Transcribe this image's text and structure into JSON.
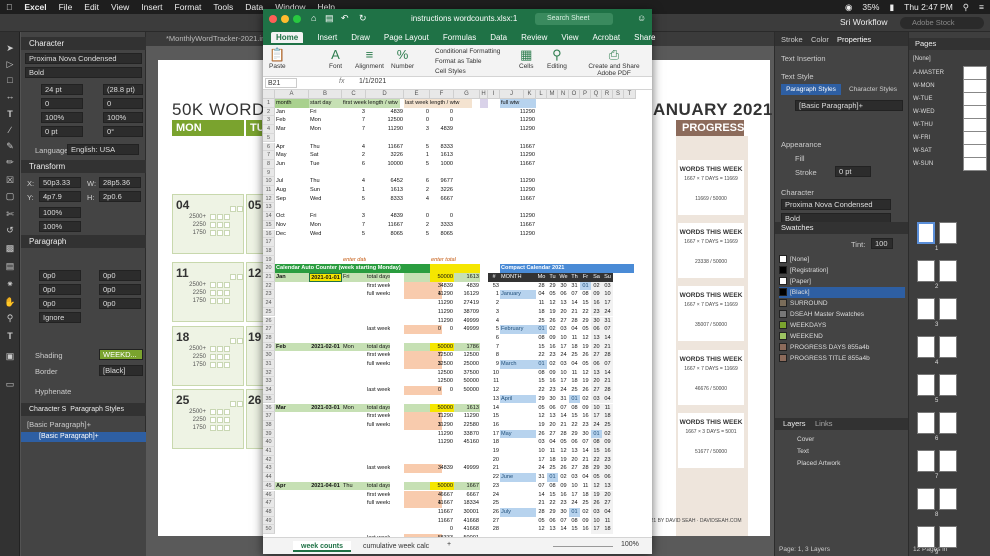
{
  "menubar": {
    "app": "Excel",
    "items": [
      "File",
      "Edit",
      "View",
      "Insert",
      "Format",
      "Tools",
      "Data",
      "Window",
      "Help"
    ],
    "battery": "35%",
    "time": "Thu 2:47 PM"
  },
  "indesign": {
    "doc_tab": "*MonthlyWordTracker-2021.indd @ 1",
    "workspace": "Sri Workflow",
    "search_placeholder": "Adobe Stock"
  },
  "character": {
    "title": "Character",
    "font": "Proxima Nova Condensed",
    "style": "Bold",
    "size": "24 pt",
    "leading": "(28.8 pt)",
    "tracking": "0",
    "kern": "0",
    "scale_v": "100%",
    "scale_h": "100%",
    "baseline": "0 pt",
    "skew": "0°",
    "language_label": "Language:",
    "language": "English: USA"
  },
  "transform": {
    "title": "Transform",
    "x": "50p3.33",
    "y": "4p7.9",
    "w": "28p5.36",
    "h": "2p0.6"
  },
  "paragraph": {
    "title": "Paragraph",
    "indent1": "0p0",
    "indent2": "0p0",
    "indent3": "0p0",
    "indent4": "0p0",
    "space1": "0p0",
    "space2": "0p0",
    "mode": "Ignore",
    "shading_label": "Shading",
    "shading": "WEEKD...",
    "border_label": "Border",
    "border": "[Black]",
    "hyphenate": "Hyphenate"
  },
  "pstyles": {
    "tab1": "Character S",
    "tab2": "Paragraph Styles",
    "current": "[Basic Paragraph]+",
    "item": "[Basic Paragraph]+"
  },
  "doc": {
    "title_left": "50K WORD TR",
    "title_right": "ANUARY 2021",
    "days": [
      "MON",
      "TU"
    ],
    "progress": "PROGRESS",
    "dates_mon": [
      "04",
      "11",
      "18",
      "25"
    ],
    "dates_tue": [
      "05",
      "12",
      "19",
      "26"
    ],
    "targets": [
      "2500+",
      "2250",
      "1750"
    ],
    "footer": "© 2021 BY DAVID SEAH · DAVIDSEAH.COM",
    "progress_blocks": [
      {
        "t": "WORDS THIS WEEK",
        "s": "1667 × 7 DAYS = 11669",
        "v": "11669 / 50000"
      },
      {
        "t": "WORDS THIS WEEK",
        "s": "1667 × 7 DAYS = 11669",
        "v": "23338 / 50000"
      },
      {
        "t": "WORDS THIS WEEK",
        "s": "1667 × 7 DAYS = 11669",
        "v": "35007 / 50000"
      },
      {
        "t": "WORDS THIS WEEK",
        "s": "1667 × 7 DAYS = 11669",
        "v": "46676 / 50000"
      },
      {
        "t": "WORDS THIS WEEK",
        "s": "1667 × 3 DAYS = 5001",
        "v": "51677 / 50000"
      }
    ]
  },
  "props": {
    "tabs": [
      "Stroke",
      "Color",
      "Properties"
    ],
    "text_insertion": "Text Insertion",
    "text_style": "Text Style",
    "ps_tab": "Paragraph Styles",
    "cs_tab": "Character Styles",
    "para_style": "[Basic Paragraph]+",
    "appearance": "Appearance",
    "fill": "Fill",
    "stroke": "Stroke",
    "stroke_val": "0 pt",
    "character": "Character",
    "font": "Proxima Nova Condensed",
    "weight": "Bold"
  },
  "swatches": {
    "title": "Swatches",
    "tint_label": "Tint:",
    "tint": "100",
    "items": [
      "[None]",
      "[Registration]",
      "[Paper]",
      "[Black]",
      "SURROUND",
      "DSEAH Master Swatches",
      "WEEKDAYS",
      "WEEKEND",
      "PROGRESS DAYS 855a4b",
      "PROGRESS TITLE 855a4b"
    ]
  },
  "layers": {
    "tabs": [
      "Layers",
      "Links"
    ],
    "items": [
      "Cover",
      "Text",
      "Placed Artwork"
    ],
    "footer": "Page: 1, 3 Layers"
  },
  "pages": {
    "title": "Pages",
    "none": "[None]",
    "masters": [
      "A-MASTER",
      "W-MON",
      "W-TUE",
      "W-WED",
      "W-THU",
      "W-FRI",
      "W-SAT",
      "W-SUN"
    ],
    "numbers": [
      "1",
      "2",
      "3",
      "4",
      "5",
      "6",
      "7",
      "8",
      "9",
      "10"
    ],
    "footer": "12 Pages in"
  },
  "excel": {
    "title": "instructions wordcounts.xlsx:1",
    "search": "Search Sheet",
    "tabs": [
      "Home",
      "Insert",
      "Draw",
      "Page Layout",
      "Formulas",
      "Data",
      "Review",
      "View",
      "Acrobat"
    ],
    "share": "Share",
    "ribbon": [
      "Paste",
      "Font",
      "Alignment",
      "Number",
      "Conditional Formatting",
      "Format as Table",
      "Cell Styles",
      "Cells",
      "Editing",
      "Create and Share Adobe PDF"
    ],
    "namebox": "B21",
    "fx": "fx",
    "formula": "1/1/2021",
    "cols": [
      "A",
      "B",
      "C",
      "D",
      "E",
      "F",
      "G",
      "H",
      "I",
      "J",
      "K",
      "L",
      "M",
      "N",
      "O",
      "P",
      "Q",
      "R",
      "S",
      "T"
    ],
    "headers": [
      "month",
      "start day",
      "first week length / wtw",
      "last week length / wtw",
      "full wtw"
    ],
    "months": [
      [
        "Jan",
        "Fri",
        "3",
        "4839",
        "0",
        "0",
        "11290"
      ],
      [
        "Feb",
        "Mon",
        "7",
        "12500",
        "0",
        "0",
        "11290"
      ],
      [
        "Mar",
        "Mon",
        "7",
        "11290",
        "3",
        "4839",
        "11290"
      ],
      [
        "",
        "",
        "",
        "",
        "",
        "",
        ""
      ],
      [
        "Apr",
        "Thu",
        "4",
        "11667",
        "5",
        "8333",
        "11667"
      ],
      [
        "May",
        "Sat",
        "2",
        "3226",
        "1",
        "1613",
        "11290"
      ],
      [
        "Jun",
        "Tue",
        "6",
        "10000",
        "5",
        "1000",
        "11667"
      ],
      [
        "",
        "",
        "",
        "",
        "",
        "",
        ""
      ],
      [
        "Jul",
        "Thu",
        "4",
        "6452",
        "6",
        "9677",
        "11290"
      ],
      [
        "Aug",
        "Sun",
        "1",
        "1613",
        "2",
        "3226",
        "11290"
      ],
      [
        "Sep",
        "Wed",
        "5",
        "8333",
        "4",
        "6667",
        "11667"
      ],
      [
        "",
        "",
        "",
        "",
        "",
        "",
        ""
      ],
      [
        "Oct",
        "Fri",
        "3",
        "4839",
        "0",
        "0",
        "11290"
      ],
      [
        "Nov",
        "Mon",
        "7",
        "11667",
        "2",
        "3333",
        "11667"
      ],
      [
        "Dec",
        "Wed",
        "5",
        "8065",
        "5",
        "8065",
        "11290"
      ]
    ],
    "auto_title": "Calendar Auto Counter (week starting Monday)",
    "enter_date": "enter date",
    "enter_total": "enter total",
    "compact_title": "Compact Calendar 2021",
    "counter": [
      [
        "21",
        "Jan",
        "2021-01-01",
        "Fri",
        "total days",
        "31",
        "50000",
        "1613"
      ],
      [
        "22",
        "",
        "",
        "",
        "first week",
        "3",
        "4839",
        "4839"
      ],
      [
        "23",
        "",
        "",
        "",
        "full weeks",
        "4",
        "11290",
        "16129"
      ],
      [
        "24",
        "",
        "",
        "",
        "",
        "",
        "11290",
        "27419"
      ],
      [
        "25",
        "",
        "",
        "",
        "",
        "",
        "11290",
        "38709"
      ],
      [
        "26",
        "",
        "",
        "",
        "",
        "",
        "11290",
        "49999"
      ],
      [
        "27",
        "",
        "",
        "",
        "last week",
        "0",
        "0",
        "49999"
      ],
      [
        "28",
        "",
        "",
        "",
        "",
        "",
        "",
        ""
      ],
      [
        "29",
        "Feb",
        "2021-02-01",
        "Mon",
        "total days",
        "28",
        "50000",
        "1786"
      ],
      [
        "30",
        "",
        "",
        "",
        "first week",
        "7",
        "12500",
        "12500"
      ],
      [
        "31",
        "",
        "",
        "",
        "full weeks",
        "3",
        "12500",
        "25000"
      ],
      [
        "32",
        "",
        "",
        "",
        "",
        "",
        "12500",
        "37500"
      ],
      [
        "33",
        "",
        "",
        "",
        "",
        "",
        "12500",
        "50000"
      ],
      [
        "34",
        "",
        "",
        "",
        "last week",
        "0",
        "0",
        "50000"
      ],
      [
        "35",
        "",
        "",
        "",
        "",
        "",
        "",
        ""
      ],
      [
        "36",
        "Mar",
        "2021-03-01",
        "Mon",
        "total days",
        "31",
        "50000",
        "1613"
      ],
      [
        "37",
        "",
        "",
        "",
        "first week",
        "7",
        "11290",
        "11290"
      ],
      [
        "38",
        "",
        "",
        "",
        "full weeks",
        "3",
        "11290",
        "22580"
      ],
      [
        "39",
        "",
        "",
        "",
        "",
        "",
        "11290",
        "33870"
      ],
      [
        "40",
        "",
        "",
        "",
        "",
        "",
        "11290",
        "45160"
      ],
      [
        "41",
        "",
        "",
        "",
        "",
        "",
        "",
        ""
      ],
      [
        "42",
        "",
        "",
        "",
        "",
        "",
        "",
        ""
      ],
      [
        "43",
        "",
        "",
        "",
        "last week",
        "3",
        "4839",
        "49999"
      ],
      [
        "44",
        "",
        "",
        "",
        "",
        "",
        "",
        ""
      ],
      [
        "45",
        "Apr",
        "2021-04-01",
        "Thu",
        "total days",
        "30",
        "50000",
        "1667"
      ],
      [
        "46",
        "",
        "",
        "",
        "first week",
        "4",
        "6667",
        "6667"
      ],
      [
        "47",
        "",
        "",
        "",
        "full weeks",
        "4",
        "11667",
        "18334"
      ],
      [
        "48",
        "",
        "",
        "",
        "",
        "",
        "11667",
        "30001"
      ],
      [
        "49",
        "",
        "",
        "",
        "",
        "",
        "11667",
        "41668"
      ],
      [
        "50",
        "",
        "",
        "",
        "",
        "",
        "0",
        "41668"
      ],
      [
        "51",
        "",
        "",
        "",
        "last week",
        "5",
        "8333",
        "50001"
      ],
      [
        "52",
        "",
        "",
        "",
        "",
        "",
        "",
        ""
      ],
      [
        "53",
        "",
        "",
        "",
        "",
        "",
        "",
        ""
      ]
    ],
    "compact_head": [
      "#",
      "MONTH",
      "Mo",
      "Tu",
      "We",
      "Th",
      "Fr",
      "Sa",
      "Su"
    ],
    "compact": [
      [
        "53",
        "",
        "28",
        "29",
        "30",
        "31",
        "01",
        "02",
        "03"
      ],
      [
        "1",
        "January",
        "04",
        "05",
        "06",
        "07",
        "08",
        "09",
        "10"
      ],
      [
        "2",
        "",
        "11",
        "12",
        "13",
        "14",
        "15",
        "16",
        "17"
      ],
      [
        "3",
        "",
        "18",
        "19",
        "20",
        "21",
        "22",
        "23",
        "24"
      ],
      [
        "4",
        "",
        "25",
        "26",
        "27",
        "28",
        "29",
        "30",
        "31"
      ],
      [
        "5",
        "February",
        "01",
        "02",
        "03",
        "04",
        "05",
        "06",
        "07"
      ],
      [
        "6",
        "",
        "08",
        "09",
        "10",
        "11",
        "12",
        "13",
        "14"
      ],
      [
        "7",
        "",
        "15",
        "16",
        "17",
        "18",
        "19",
        "20",
        "21"
      ],
      [
        "8",
        "",
        "22",
        "23",
        "24",
        "25",
        "26",
        "27",
        "28"
      ],
      [
        "9",
        "March",
        "01",
        "02",
        "03",
        "04",
        "05",
        "06",
        "07"
      ],
      [
        "10",
        "",
        "08",
        "09",
        "10",
        "11",
        "12",
        "13",
        "14"
      ],
      [
        "11",
        "",
        "15",
        "16",
        "17",
        "18",
        "19",
        "20",
        "21"
      ],
      [
        "12",
        "",
        "22",
        "23",
        "24",
        "25",
        "26",
        "27",
        "28"
      ],
      [
        "13",
        "April",
        "29",
        "30",
        "31",
        "01",
        "02",
        "03",
        "04"
      ],
      [
        "14",
        "",
        "05",
        "06",
        "07",
        "08",
        "09",
        "10",
        "11"
      ],
      [
        "15",
        "",
        "12",
        "13",
        "14",
        "15",
        "16",
        "17",
        "18"
      ],
      [
        "16",
        "",
        "19",
        "20",
        "21",
        "22",
        "23",
        "24",
        "25"
      ],
      [
        "17",
        "May",
        "26",
        "27",
        "28",
        "29",
        "30",
        "01",
        "02"
      ],
      [
        "18",
        "",
        "03",
        "04",
        "05",
        "06",
        "07",
        "08",
        "09"
      ],
      [
        "19",
        "",
        "10",
        "11",
        "12",
        "13",
        "14",
        "15",
        "16"
      ],
      [
        "20",
        "",
        "17",
        "18",
        "19",
        "20",
        "21",
        "22",
        "23"
      ],
      [
        "21",
        "",
        "24",
        "25",
        "26",
        "27",
        "28",
        "29",
        "30"
      ],
      [
        "22",
        "June",
        "31",
        "01",
        "02",
        "03",
        "04",
        "05",
        "06"
      ],
      [
        "23",
        "",
        "07",
        "08",
        "09",
        "10",
        "11",
        "12",
        "13"
      ],
      [
        "24",
        "",
        "14",
        "15",
        "16",
        "17",
        "18",
        "19",
        "20"
      ],
      [
        "25",
        "",
        "21",
        "22",
        "23",
        "24",
        "25",
        "26",
        "27"
      ],
      [
        "26",
        "July",
        "28",
        "29",
        "30",
        "01",
        "02",
        "03",
        "04"
      ],
      [
        "27",
        "",
        "05",
        "06",
        "07",
        "08",
        "09",
        "10",
        "11"
      ],
      [
        "28",
        "",
        "12",
        "13",
        "14",
        "15",
        "16",
        "17",
        "18"
      ]
    ],
    "sheets": [
      "week counts",
      "cumulative week calc"
    ],
    "zoom": "100%"
  },
  "colors": {
    "green": "#7aa32e",
    "excel": "#1f7246",
    "yellow": "#f5e600",
    "blue": "#b7d3ee",
    "progress": "#8c6b5b"
  }
}
